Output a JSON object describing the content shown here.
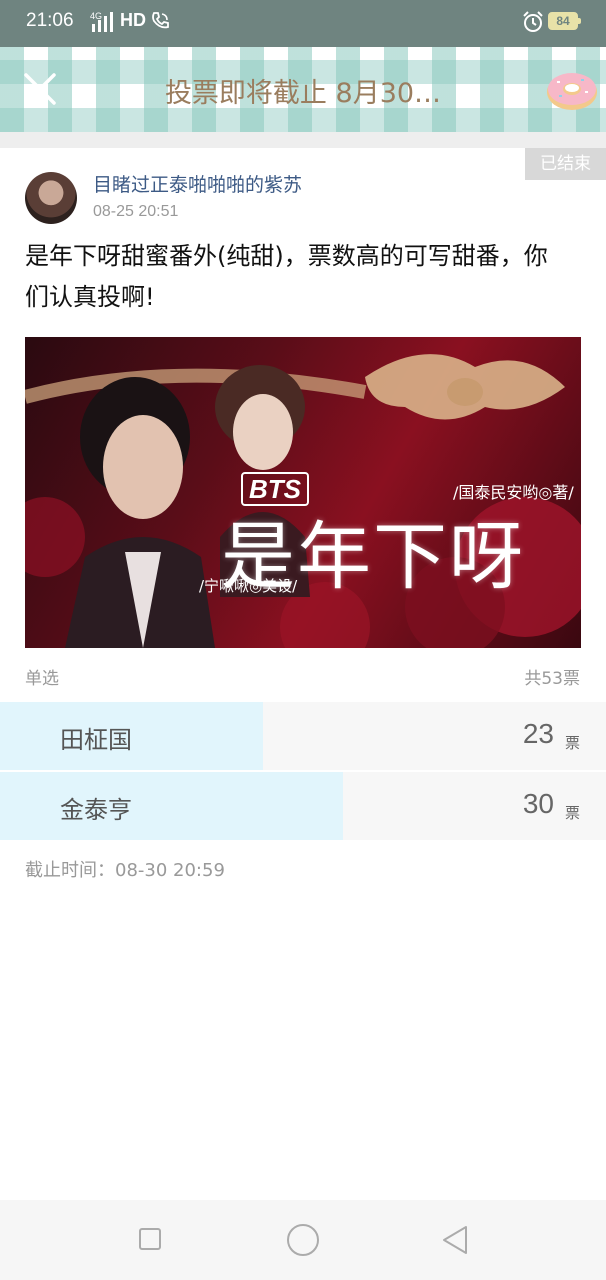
{
  "status_bar": {
    "time": "21:06",
    "network": "4G",
    "hd": "HD",
    "battery": "84",
    "background": "#6f8480"
  },
  "header": {
    "title": "投票即将截止 8月30…",
    "close_icon": "close-icon",
    "mascot_icon": "donut-icon"
  },
  "post": {
    "status_badge": "已结束",
    "author": "目睹过正泰啪啪啪的紫苏",
    "time": "08-25 20:51",
    "text": "是年下呀甜蜜番外(纯甜)，票数高的可写甜番，你们认真投啊!",
    "banner": {
      "bts": "BTS",
      "title": "是年下呀",
      "author_credit": "/国泰民安哟◎著/",
      "design_credit": "/宁啾啾◎美设/"
    }
  },
  "vote": {
    "type": "单选",
    "total": "共53票",
    "unit": "票",
    "options": [
      {
        "label": "田柾国",
        "count": "23",
        "fraction": 0.434
      },
      {
        "label": "金泰亨",
        "count": "30",
        "fraction": 0.566
      }
    ],
    "deadline": "截止时间：08-30 20:59"
  },
  "colors": {
    "accent_title": "#9a7d5e",
    "author_link": "#3d5a85",
    "vote_fill": "#e1f5fc"
  }
}
